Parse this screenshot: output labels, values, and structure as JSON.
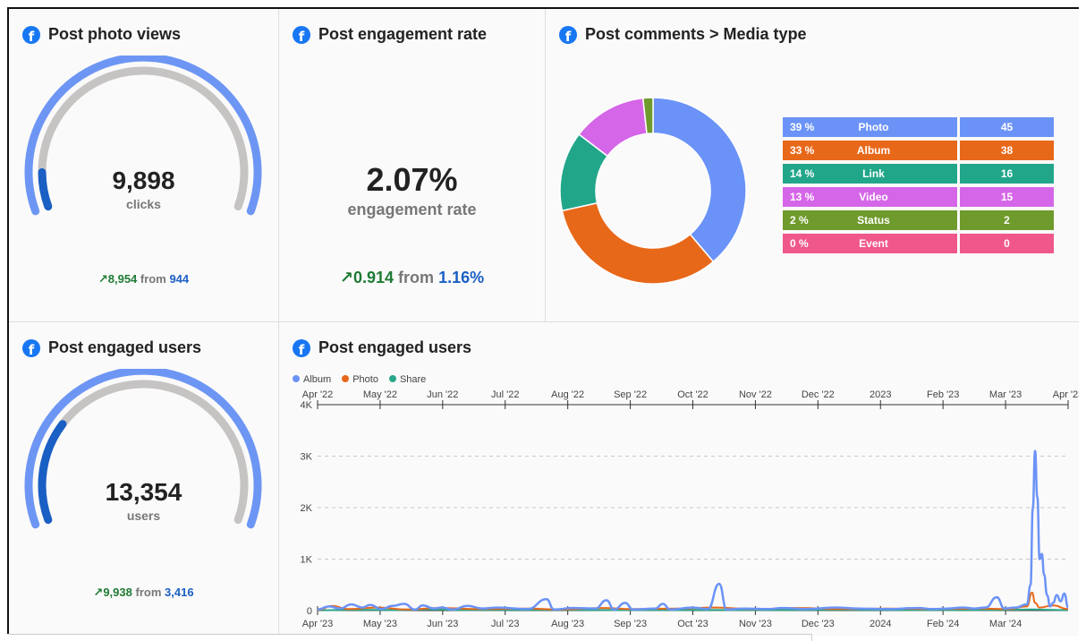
{
  "colors": {
    "gauge_outer": "#6d96f4",
    "gauge_inner": "#c6c3c3",
    "gauge_fill": "#1a5fc4",
    "album": "#6b93f7",
    "photo_line": "#e8681a",
    "share": "#2aa68a"
  },
  "photo_views": {
    "title": "Post photo views",
    "icon": "facebook-icon",
    "value": "9,898",
    "unit": "clicks",
    "change_arrow": "↗",
    "change": "8,954",
    "from_label": "from",
    "previous": "944",
    "fill_fraction": 0.09
  },
  "engagement_rate": {
    "title": "Post engagement rate",
    "icon": "facebook-icon",
    "value": "2.07%",
    "unit": "engagement rate",
    "change_arrow": "↗",
    "change": "0.914",
    "from_label": "from",
    "previous": "1.16%"
  },
  "comments_media": {
    "title": "Post comments > Media type",
    "icon": "facebook-icon",
    "rows": [
      {
        "pct": "39 %",
        "name": "Photo",
        "value": "45",
        "color": "#6b93f7"
      },
      {
        "pct": "33 %",
        "name": "Album",
        "value": "38",
        "color": "#e8681a"
      },
      {
        "pct": "14 %",
        "name": "Link",
        "value": "16",
        "color": "#22a68a"
      },
      {
        "pct": "13 %",
        "name": "Video",
        "value": "15",
        "color": "#d566e8"
      },
      {
        "pct": "2 %",
        "name": "Status",
        "value": "2",
        "color": "#6f9a2c"
      },
      {
        "pct": "0 %",
        "name": "Event",
        "value": "0",
        "color": "#f0578a"
      }
    ]
  },
  "engaged_users_gauge": {
    "title": "Post engaged users",
    "icon": "facebook-icon",
    "value": "13,354",
    "unit": "users",
    "change_arrow": "↗",
    "change": "9,938",
    "from_label": "from",
    "previous": "3,416",
    "fill_fraction": 0.26
  },
  "engaged_users_chart": {
    "title": "Post engaged users",
    "icon": "facebook-icon",
    "legend": [
      "Album",
      "Photo",
      "Share"
    ]
  },
  "chart_data": {
    "type": "line",
    "title": "Post engaged users",
    "top_axis_ticks": [
      "Apr '22",
      "May '22",
      "Jun '22",
      "Jul '22",
      "Aug '22",
      "Sep '22",
      "Oct '22",
      "Nov '22",
      "Dec '22",
      "2023",
      "Feb '23",
      "Mar '23",
      "Apr '23"
    ],
    "bottom_axis_ticks": [
      "Apr '23",
      "May '23",
      "Jun '23",
      "Jul '23",
      "Aug '23",
      "Sep '23",
      "Oct '23",
      "Nov '23",
      "Dec '23",
      "2024",
      "Feb '24",
      "Mar '24"
    ],
    "y_ticks": [
      "4K",
      "3K",
      "2K",
      "1K",
      "0"
    ],
    "ylim": [
      0,
      4000
    ],
    "grid": true,
    "legend_position": "top-left",
    "series": [
      {
        "name": "Album",
        "points": [
          [
            0.0,
            20
          ],
          [
            0.015,
            80
          ],
          [
            0.03,
            40
          ],
          [
            0.045,
            120
          ],
          [
            0.06,
            60
          ],
          [
            0.07,
            110
          ],
          [
            0.085,
            30
          ],
          [
            0.1,
            90
          ],
          [
            0.115,
            130
          ],
          [
            0.13,
            20
          ],
          [
            0.14,
            100
          ],
          [
            0.155,
            40
          ],
          [
            0.165,
            60
          ],
          [
            0.18,
            20
          ],
          [
            0.2,
            90
          ],
          [
            0.22,
            40
          ],
          [
            0.24,
            60
          ],
          [
            0.28,
            30
          ],
          [
            0.305,
            220
          ],
          [
            0.315,
            20
          ],
          [
            0.34,
            50
          ],
          [
            0.37,
            40
          ],
          [
            0.385,
            200
          ],
          [
            0.395,
            20
          ],
          [
            0.41,
            150
          ],
          [
            0.42,
            20
          ],
          [
            0.45,
            40
          ],
          [
            0.46,
            130
          ],
          [
            0.47,
            20
          ],
          [
            0.5,
            60
          ],
          [
            0.52,
            30
          ],
          [
            0.535,
            520
          ],
          [
            0.545,
            20
          ],
          [
            0.57,
            40
          ],
          [
            0.6,
            30
          ],
          [
            0.62,
            50
          ],
          [
            0.65,
            30
          ],
          [
            0.69,
            60
          ],
          [
            0.72,
            40
          ],
          [
            0.76,
            30
          ],
          [
            0.8,
            50
          ],
          [
            0.82,
            30
          ],
          [
            0.84,
            40
          ],
          [
            0.86,
            60
          ],
          [
            0.875,
            40
          ],
          [
            0.89,
            60
          ],
          [
            0.905,
            260
          ],
          [
            0.915,
            40
          ],
          [
            0.93,
            60
          ],
          [
            0.945,
            120
          ],
          [
            0.95,
            500
          ],
          [
            0.953,
            2000
          ],
          [
            0.956,
            3100
          ],
          [
            0.959,
            2200
          ],
          [
            0.962,
            1000
          ],
          [
            0.965,
            1100
          ],
          [
            0.968,
            700
          ],
          [
            0.972,
            300
          ],
          [
            0.976,
            80
          ],
          [
            0.98,
            150
          ],
          [
            0.985,
            300
          ],
          [
            0.99,
            180
          ],
          [
            0.995,
            330
          ],
          [
            1.0,
            60
          ]
        ]
      },
      {
        "name": "Photo",
        "points": [
          [
            0.0,
            10
          ],
          [
            0.02,
            90
          ],
          [
            0.04,
            30
          ],
          [
            0.08,
            60
          ],
          [
            0.12,
            20
          ],
          [
            0.16,
            50
          ],
          [
            0.22,
            30
          ],
          [
            0.28,
            40
          ],
          [
            0.32,
            20
          ],
          [
            0.38,
            50
          ],
          [
            0.42,
            30
          ],
          [
            0.48,
            40
          ],
          [
            0.53,
            60
          ],
          [
            0.58,
            30
          ],
          [
            0.64,
            50
          ],
          [
            0.7,
            30
          ],
          [
            0.76,
            40
          ],
          [
            0.82,
            30
          ],
          [
            0.88,
            40
          ],
          [
            0.92,
            30
          ],
          [
            0.945,
            80
          ],
          [
            0.952,
            350
          ],
          [
            0.956,
            150
          ],
          [
            0.962,
            60
          ],
          [
            0.98,
            100
          ],
          [
            1.0,
            30
          ]
        ]
      },
      {
        "name": "Share",
        "points": [
          [
            0.0,
            5
          ],
          [
            0.05,
            15
          ],
          [
            0.1,
            8
          ],
          [
            0.15,
            20
          ],
          [
            0.2,
            10
          ],
          [
            0.3,
            15
          ],
          [
            0.4,
            8
          ],
          [
            0.5,
            12
          ],
          [
            0.6,
            10
          ],
          [
            0.7,
            15
          ],
          [
            0.8,
            10
          ],
          [
            0.9,
            12
          ],
          [
            0.95,
            20
          ],
          [
            1.0,
            10
          ]
        ]
      }
    ]
  },
  "donut_data": {
    "type": "pie",
    "categories": [
      "Photo",
      "Album",
      "Link",
      "Video",
      "Status",
      "Event"
    ],
    "values": [
      45,
      38,
      16,
      15,
      2,
      0
    ]
  }
}
